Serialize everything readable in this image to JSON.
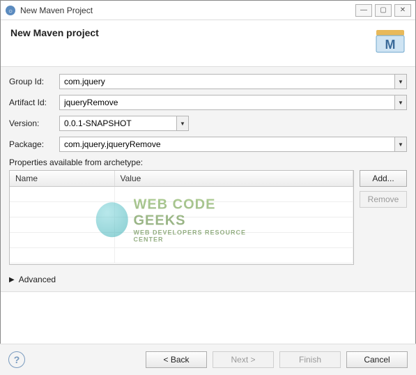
{
  "window": {
    "title": "New Maven Project",
    "controls": {
      "minimize": "—",
      "maximize": "▢",
      "close": "✕"
    }
  },
  "header": {
    "title": "New Maven project"
  },
  "fields": {
    "groupId": {
      "label": "Group Id:",
      "value": "com.jquery"
    },
    "artifactId": {
      "label": "Artifact Id:",
      "value": "jqueryRemove"
    },
    "version": {
      "label": "Version:",
      "value": "0.0.1-SNAPSHOT"
    },
    "pkg": {
      "label": "Package:",
      "value": "com.jquery.jqueryRemove"
    }
  },
  "properties": {
    "label": "Properties available from archetype:",
    "columns": {
      "name": "Name",
      "value": "Value"
    },
    "buttons": {
      "add": "Add...",
      "remove": "Remove"
    }
  },
  "advanced": {
    "label": "Advanced"
  },
  "footer": {
    "back": "< Back",
    "next": "Next >",
    "finish": "Finish",
    "cancel": "Cancel"
  },
  "watermark": {
    "line1": "WEB CODE GEEKS",
    "line2": "WEB DEVELOPERS RESOURCE CENTER"
  }
}
